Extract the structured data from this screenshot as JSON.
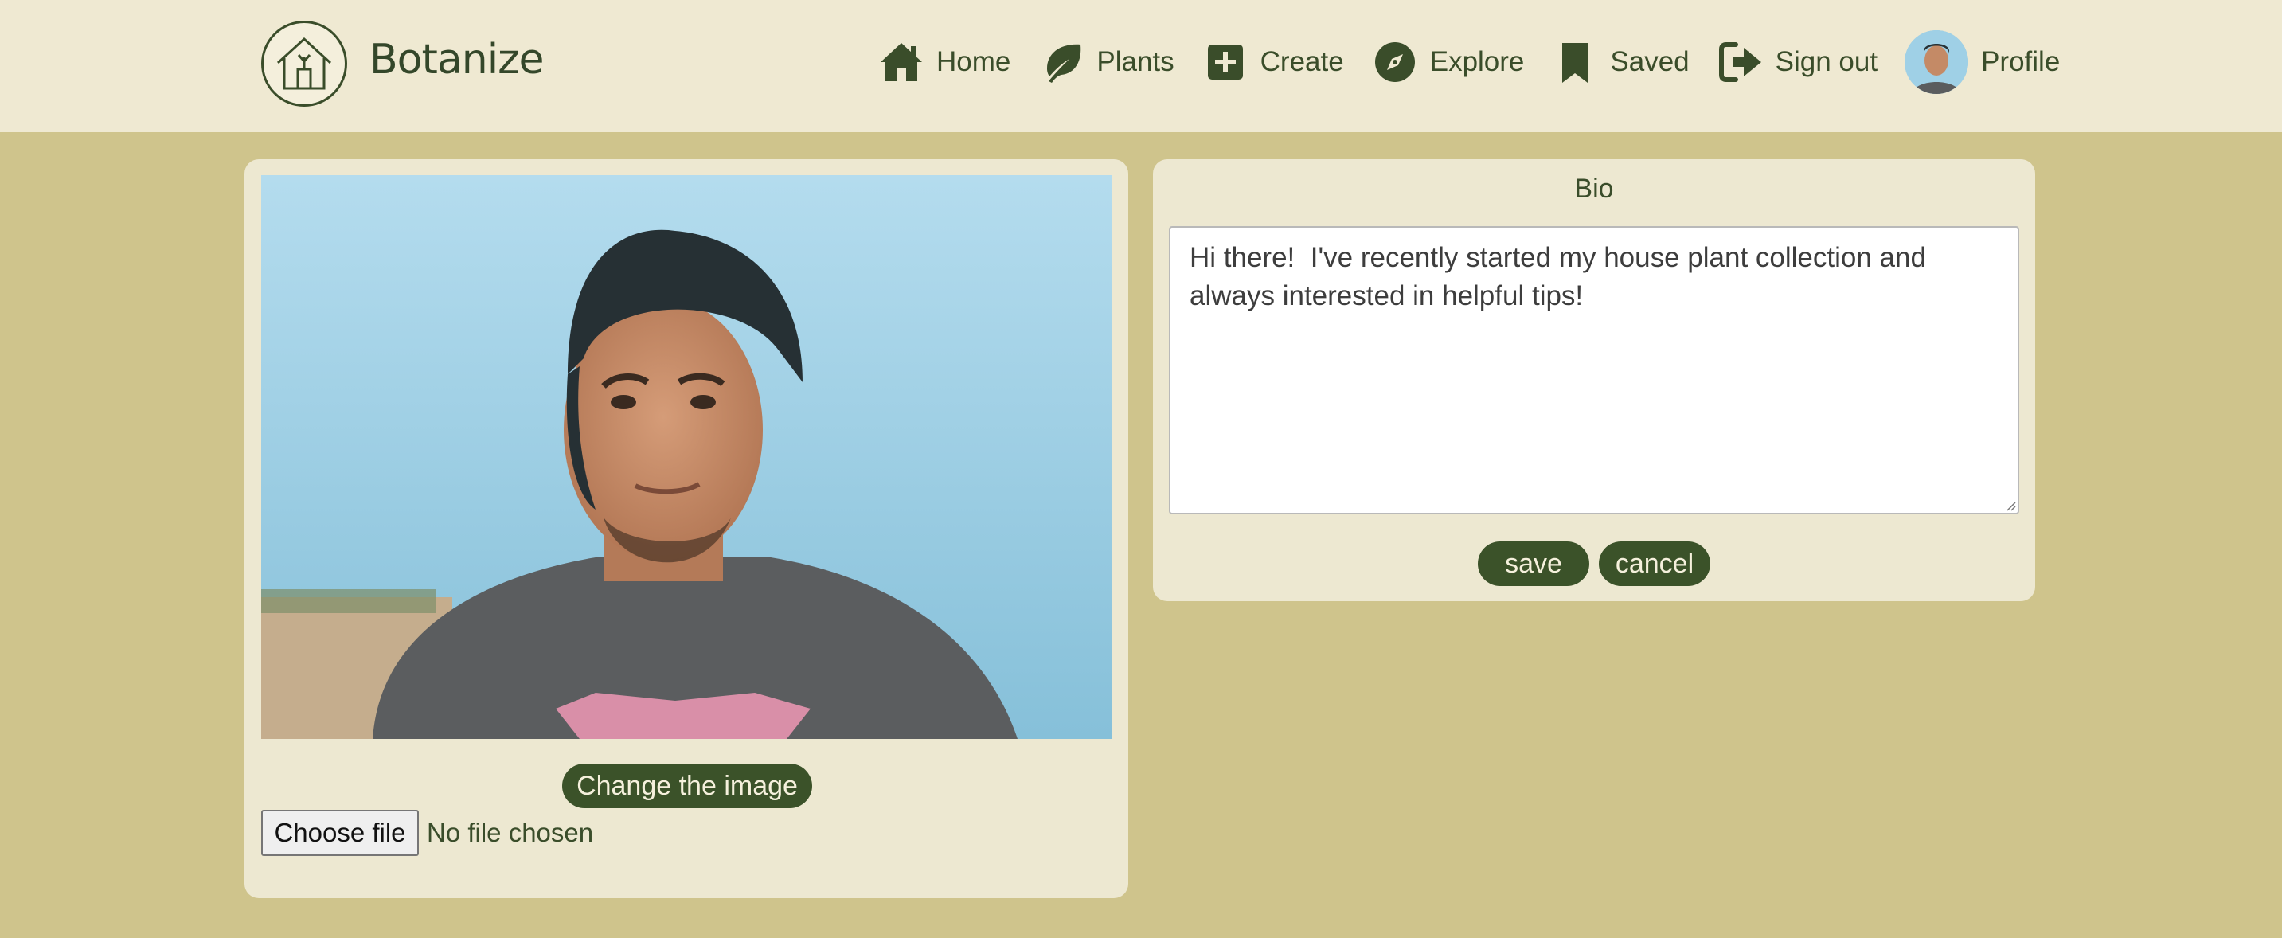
{
  "header": {
    "brand": "Botanize",
    "logo_icon": "house-plant-logo-icon",
    "nav": [
      {
        "label": "Home",
        "icon": "home-icon"
      },
      {
        "label": "Plants",
        "icon": "leaf-icon"
      },
      {
        "label": "Create",
        "icon": "plus-square-icon"
      },
      {
        "label": "Explore",
        "icon": "compass-icon"
      },
      {
        "label": "Saved",
        "icon": "bookmark-icon"
      },
      {
        "label": "Sign out",
        "icon": "sign-out-icon"
      },
      {
        "label": "Profile",
        "icon": "avatar"
      }
    ]
  },
  "profile_image": {
    "change_label": "Change the image",
    "file_button_label": "Choose file",
    "file_status": "No file chosen"
  },
  "bio": {
    "title": "Bio",
    "text": "Hi there!  I've recently started my house plant collection and always interested in helpful tips!",
    "save_label": "save",
    "cancel_label": "cancel"
  },
  "colors": {
    "page_bg": "#cfc48c",
    "header_bg": "#efe9d2",
    "card_bg": "#ede8d1",
    "accent": "#3b5229"
  }
}
